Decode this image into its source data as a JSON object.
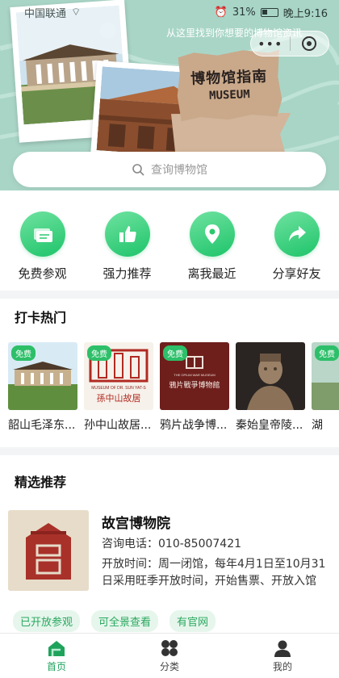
{
  "status_bar": {
    "carrier": "中国联通",
    "battery": "31%",
    "time": "晚上9:16"
  },
  "hero": {
    "subtitle": "从这里找到你想要的博物馆资讯",
    "sign_title": "博物馆指南",
    "sign_subtitle": "MUSEUM"
  },
  "search": {
    "placeholder": "查询博物馆"
  },
  "actions": [
    {
      "label": "免费参观",
      "icon": "ticket-icon"
    },
    {
      "label": "强力推荐",
      "icon": "thumbs-up-icon"
    },
    {
      "label": "离我最近",
      "icon": "location-pin-icon"
    },
    {
      "label": "分享好友",
      "icon": "share-icon"
    }
  ],
  "hot": {
    "title": "打卡热门",
    "badge": "免费",
    "items": [
      {
        "name": "韶山毛泽东..."
      },
      {
        "name": "孙中山故居..."
      },
      {
        "name": "鸦片战争博..."
      },
      {
        "name": "秦始皇帝陵..."
      },
      {
        "name": "湖"
      }
    ],
    "images": {
      "sunyatsen_caption": "MUSEUM OF DR. SUN YAT-S",
      "sunyatsen_calligraphy": "孫中山故居",
      "opium_caption": "THE OPIUM WAR MUSEUM",
      "opium_calligraphy": "鴉片戰爭博物館"
    }
  },
  "featured": {
    "title": "精选推荐",
    "item": {
      "name": "故宫博物院",
      "phone_label": "咨询电话：",
      "phone": "010-85007421",
      "hours_label": "开放时间：",
      "hours": "周一闭馆，每年4月1日至10月31日采用旺季开放时间，开始售票、开放入馆"
    },
    "tags": [
      "已开放参观",
      "可全景查看",
      "有官网"
    ]
  },
  "tabbar": [
    {
      "label": "首页",
      "icon": "home-icon",
      "active": true
    },
    {
      "label": "分类",
      "icon": "category-icon",
      "active": false
    },
    {
      "label": "我的",
      "icon": "user-icon",
      "active": false
    }
  ],
  "colors": {
    "accent": "#1ec46a",
    "hero_bg": "#a9d5c7",
    "tag_bg": "#e6f6ec"
  }
}
